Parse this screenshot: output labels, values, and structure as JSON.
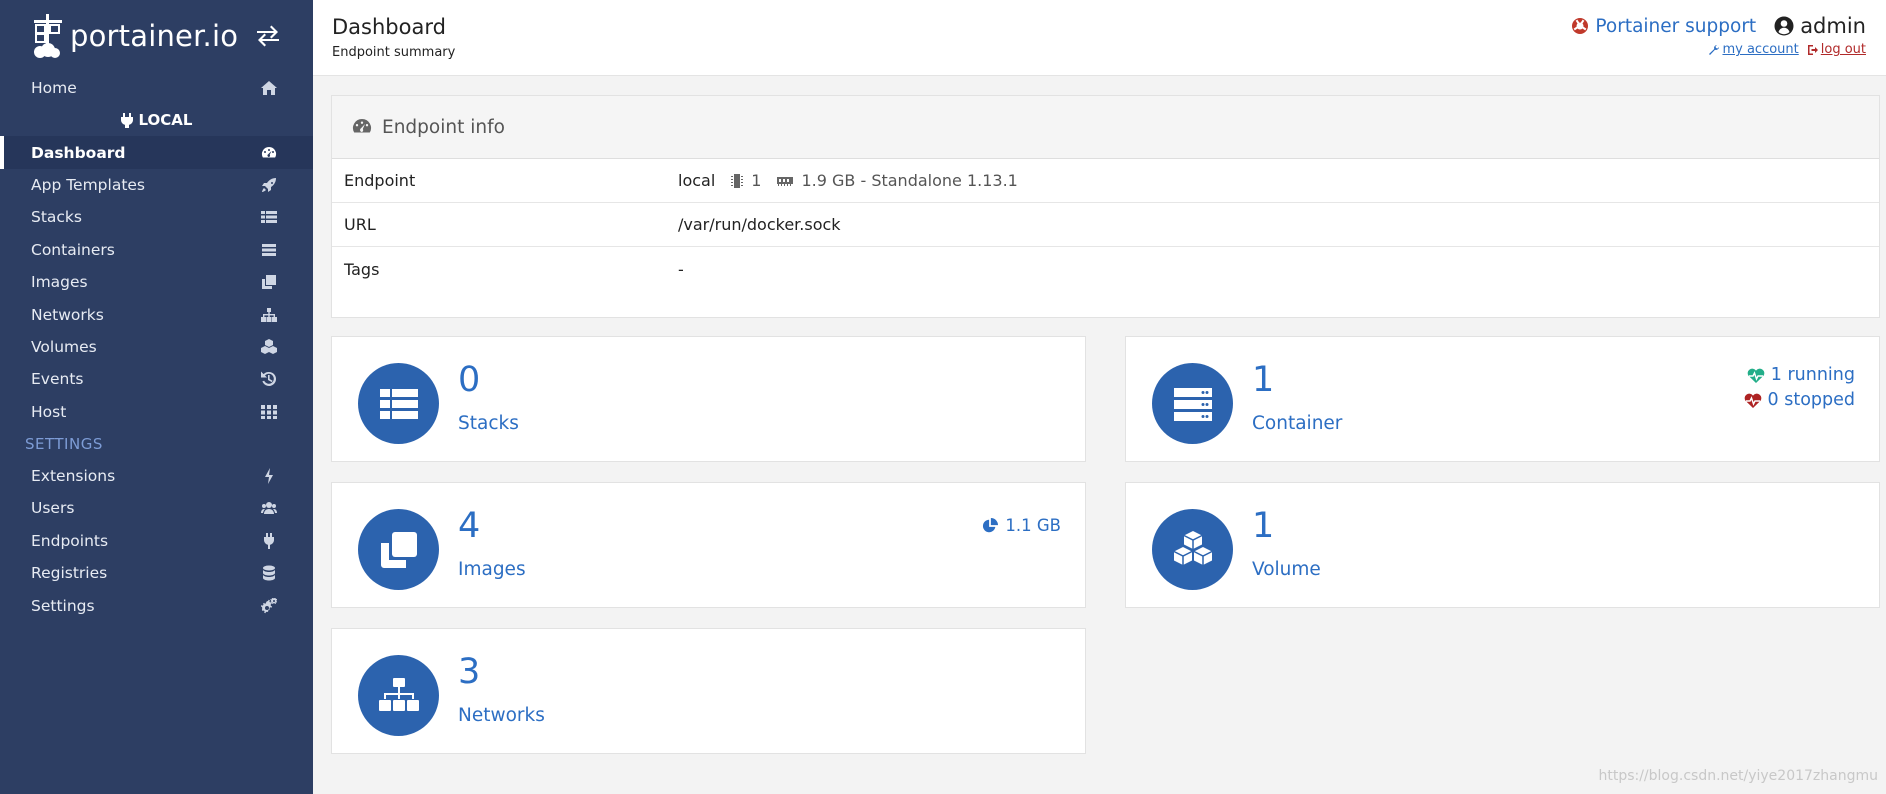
{
  "brand": {
    "logo_text": "portainer.io"
  },
  "sidebar": {
    "home": "Home",
    "local_label": "LOCAL",
    "items": [
      {
        "label": "Dashboard"
      },
      {
        "label": "App Templates"
      },
      {
        "label": "Stacks"
      },
      {
        "label": "Containers"
      },
      {
        "label": "Images"
      },
      {
        "label": "Networks"
      },
      {
        "label": "Volumes"
      },
      {
        "label": "Events"
      },
      {
        "label": "Host"
      }
    ],
    "settings_heading": "SETTINGS",
    "settings_items": [
      {
        "label": "Extensions"
      },
      {
        "label": "Users"
      },
      {
        "label": "Endpoints"
      },
      {
        "label": "Registries"
      },
      {
        "label": "Settings"
      }
    ]
  },
  "header": {
    "title": "Dashboard",
    "subtitle": "Endpoint summary",
    "support": "Portainer support",
    "user": "admin",
    "my_account": "my account",
    "log_out": "log out"
  },
  "endpoint_info": {
    "heading": "Endpoint info",
    "rows": [
      {
        "key": "Endpoint",
        "name": "local",
        "cpu": "1",
        "memory": "1.9 GB - Standalone 1.13.1"
      },
      {
        "key": "URL",
        "value": "/var/run/docker.sock"
      },
      {
        "key": "Tags",
        "value": "-"
      }
    ]
  },
  "widgets": {
    "stacks": {
      "count": "0",
      "label": "Stacks"
    },
    "containers": {
      "count": "1",
      "label": "Container",
      "running": "1 running",
      "stopped": "0 stopped"
    },
    "images": {
      "count": "4",
      "label": "Images",
      "size": "1.1 GB"
    },
    "volumes": {
      "count": "1",
      "label": "Volume"
    },
    "networks": {
      "count": "3",
      "label": "Networks"
    }
  },
  "colors": {
    "sidebar_bg": "#2d3e63",
    "accent": "#2c6ec3",
    "widget_circle": "#2c63ae",
    "running": "#23ae89",
    "stopped": "#ae2323"
  },
  "watermark": "https://blog.csdn.net/yiye2017zhangmu"
}
